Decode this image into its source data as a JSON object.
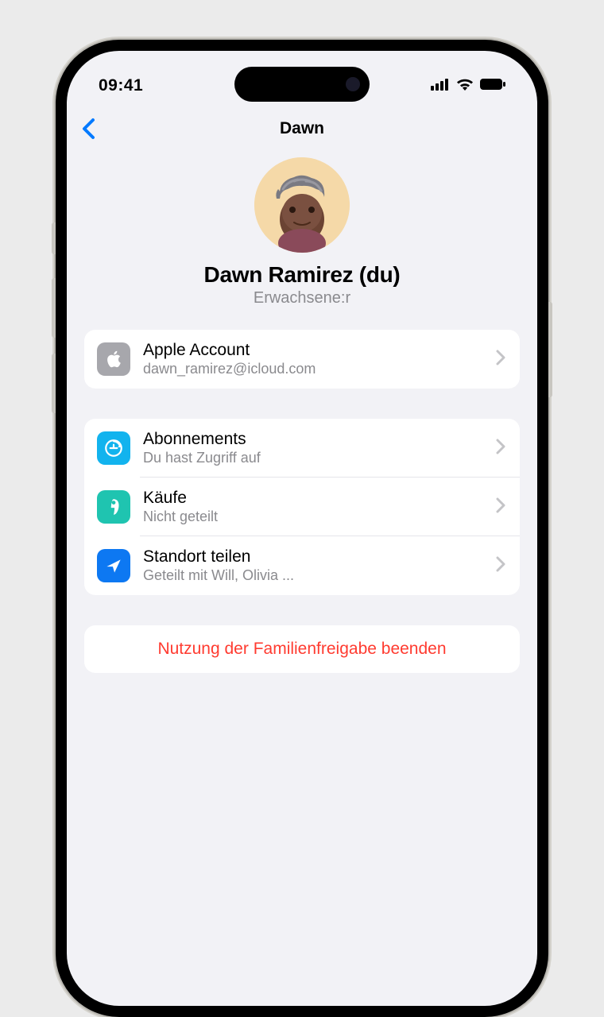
{
  "status": {
    "time": "09:41"
  },
  "nav": {
    "title": "Dawn"
  },
  "profile": {
    "name": "Dawn Ramirez (du)",
    "role": "Erwachsene:r"
  },
  "account": {
    "title": "Apple Account",
    "email": "dawn_ramirez@icloud.com"
  },
  "rows": {
    "subscriptions": {
      "title": "Abonnements",
      "subtitle": "Du hast Zugriff auf"
    },
    "purchases": {
      "title": "Käufe",
      "subtitle": "Nicht geteilt"
    },
    "location": {
      "title": "Standort teilen",
      "subtitle": "Geteilt mit Will, Olivia ..."
    }
  },
  "destructive": {
    "label": "Nutzung der Familienfreigabe beenden"
  }
}
